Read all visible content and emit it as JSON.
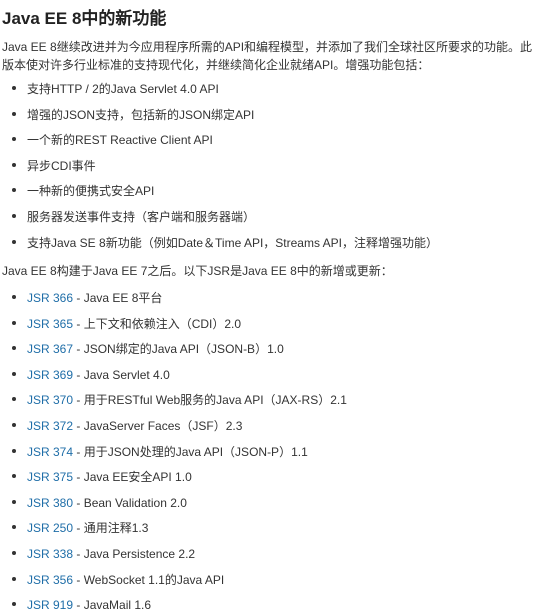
{
  "title": "Java EE 8中的新功能",
  "intro": "Java EE 8继续改进并为今应用程序所需的API和编程模型，并添加了我们全球社区所要求的功能。此版本使对许多行业标准的支持现代化，并继续简化企业就绪API。增强功能包括：",
  "features": [
    "支持HTTP / 2的Java Servlet 4.0 API",
    "增强的JSON支持，包括新的JSON绑定API",
    "一个新的REST Reactive Client API",
    "异步CDI事件",
    "一种新的便携式安全API",
    "服务器发送事件支持（客户端和服务器端）",
    "支持Java SE 8新功能（例如Date＆Time API，Streams API，注释增强功能）"
  ],
  "jsr_intro": "Java EE 8构建于Java EE 7之后。以下JSR是Java EE 8中的新增或更新：",
  "jsrs": [
    {
      "link": "JSR 366",
      "text": " - Java EE 8平台"
    },
    {
      "link": "JSR 365",
      "text": " - 上下文和依赖注入（CDI）2.0"
    },
    {
      "link": "JSR 367",
      "text": " - JSON绑定的Java API（JSON-B）1.0"
    },
    {
      "link": "JSR 369",
      "text": " - Java Servlet 4.0"
    },
    {
      "link": "JSR 370",
      "text": " - 用于RESTful Web服务的Java API（JAX-RS）2.1"
    },
    {
      "link": "JSR 372",
      "text": " - JavaServer Faces（JSF）2.3"
    },
    {
      "link": "JSR 374",
      "text": " - 用于JSON处理的Java API（JSON-P）1.1"
    },
    {
      "link": "JSR 375",
      "text": " - Java EE安全API 1.0"
    },
    {
      "link": "JSR 380",
      "text": " - Bean Validation 2.0"
    },
    {
      "link": "JSR 250",
      "text": " - 通用注释1.3"
    },
    {
      "link": "JSR 338",
      "text": " - Java Persistence 2.2"
    },
    {
      "link": "JSR 356",
      "text": " - WebSocket 1.1的Java API"
    },
    {
      "link": "JSR 919",
      "text": " - JavaMail 1.6"
    }
  ],
  "colors": {
    "link": "#1f6ea8",
    "text": "#333333",
    "title": "#222222"
  }
}
